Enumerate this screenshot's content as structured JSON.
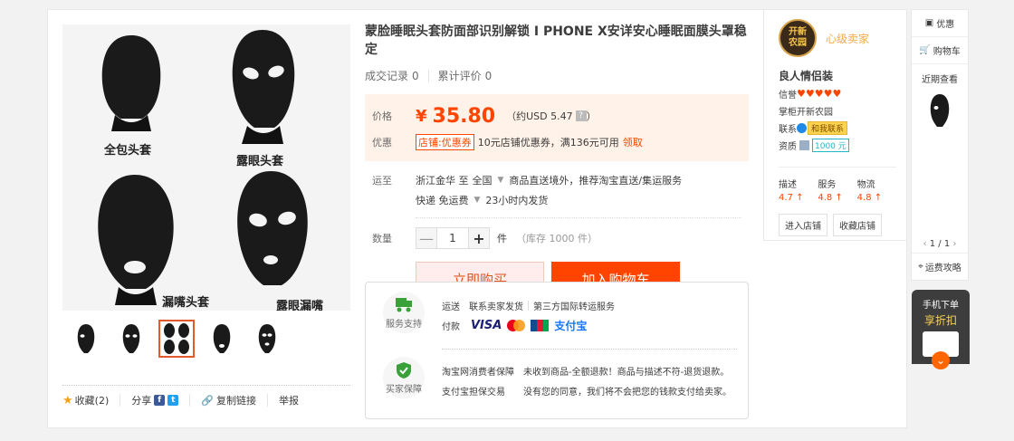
{
  "product": {
    "title": "蒙脸睡眠头套防面部识别解锁 I PHONE X安详安心睡眠面膜头罩稳定",
    "stats": {
      "deals_label": "成交记录",
      "deals": "0",
      "reviews_label": "累计评价",
      "reviews": "0"
    },
    "price_label": "价格",
    "currency_symbol": "¥",
    "price": "35.80",
    "usd": "（约USD 5.47",
    "usd_suffix": "）",
    "usd_help": "?",
    "promo_label": "优惠",
    "coupon_tag": "店铺:优惠券",
    "coupon_text": "10元店铺优惠券，满136元可用",
    "coupon_link": "领取",
    "ship_label": "运至",
    "ship_from": "浙江金华 至",
    "ship_to": "全国",
    "ship_note": "商品直送境外，推荐淘宝直送/集运服务",
    "express": "快递 免运费",
    "dispatch": "23小时内发货",
    "qty_label": "数量",
    "qty_value": "1",
    "qty_minus": "—",
    "qty_plus": "+",
    "qty_unit": "件",
    "stock": "（库存 1000 件）",
    "buy_now": "立即购买",
    "add_cart": "加入购物车"
  },
  "gallery": {
    "captions": [
      "全包头套",
      "露眼头套",
      "漏嘴头套",
      "露眼漏嘴"
    ],
    "thumb_count": 5,
    "active_thumb": 2
  },
  "actions": {
    "favorite": "收藏(2)",
    "share": "分享",
    "copy_link": "复制链接",
    "report": "举报"
  },
  "service": {
    "support_label": "服务支持",
    "guarantee_label": "买家保障",
    "ship_label": "运送",
    "ship_seller": "联系卖家发货",
    "ship_third": "第三方国际转运服务",
    "pay_label": "付款",
    "visa": "VISA",
    "alipay": "支付宝",
    "consumer": "淘宝网消费者保障",
    "consumer_desc": "未收到商品-全额退款！商品与描述不符-退货退款。",
    "escrow": "支付宝担保交易",
    "escrow_desc": "没有您的同意，我们将不会把您的钱款支付给卖家。"
  },
  "seller": {
    "logo_line1": "开新",
    "logo_line2": "农园",
    "grade": "心级卖家",
    "shop_name": "良人情侣装",
    "credit_label": "信誉",
    "hearts": "♥♥♥♥♥",
    "keeper": "掌柜开新农园",
    "contact_label": "联系",
    "contact_btn": "和我联系",
    "qual_label": "资质",
    "deposit": "1000 元",
    "ratings": [
      {
        "label": "描述",
        "value": "4.7 ↑"
      },
      {
        "label": "服务",
        "value": "4.8 ↑"
      },
      {
        "label": "物流",
        "value": "4.8 ↑"
      }
    ],
    "enter_shop": "进入店铺",
    "fav_shop": "收藏店铺"
  },
  "sidebar": {
    "promo": "优惠",
    "cart": "购物车",
    "recent": "近期查看",
    "pager_left": "‹",
    "pager": "1 / 1",
    "pager_right": "›",
    "help": "运费攻略",
    "mobile_line1": "手机下单",
    "mobile_line2": "享折扣",
    "mobile_arrow": "⌄"
  }
}
